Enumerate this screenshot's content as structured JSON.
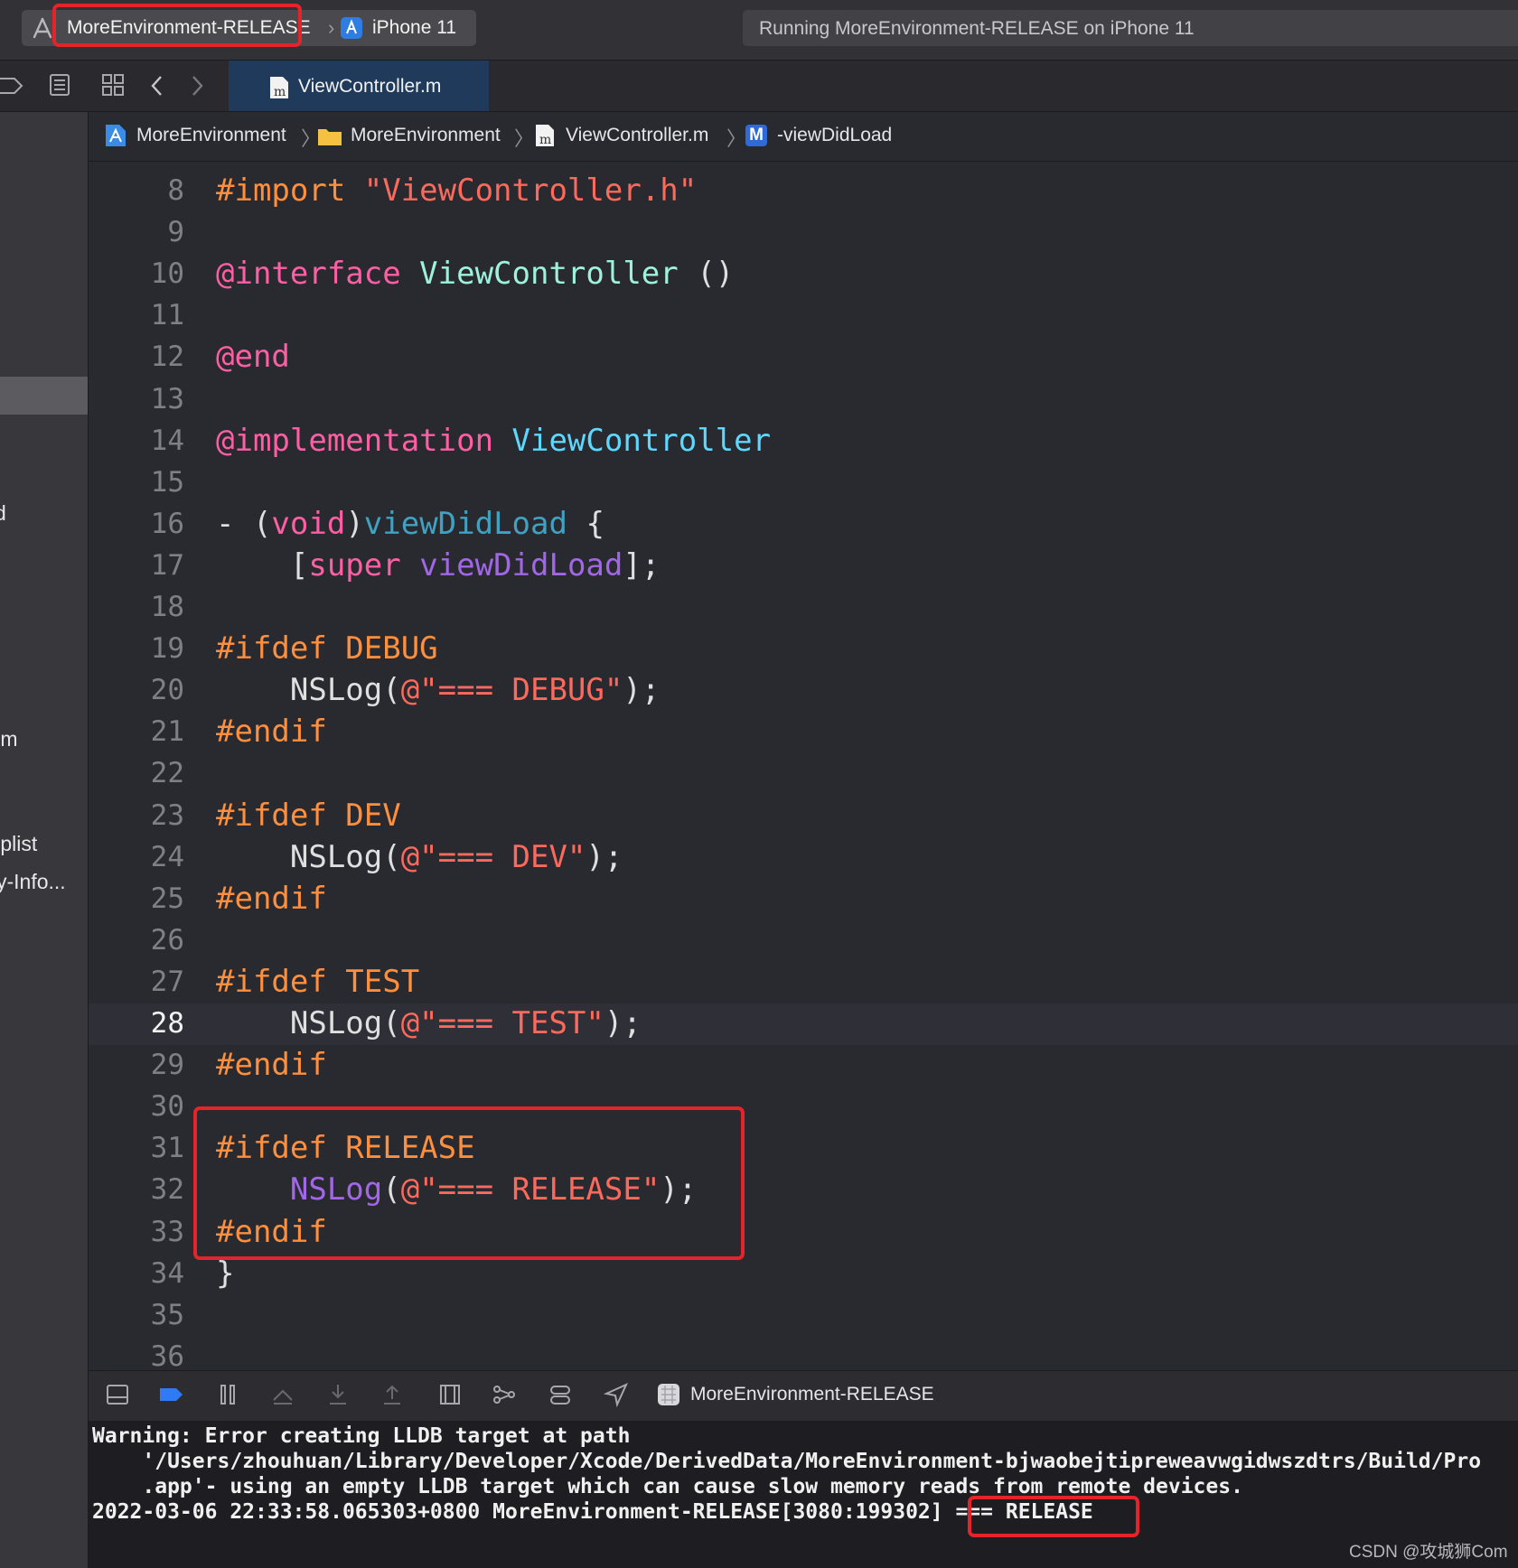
{
  "toolbar": {
    "scheme_name": "MoreEnvironment-RELEASE",
    "device_name": "iPhone 11",
    "status_text": "Running MoreEnvironment-RELEASE on iPhone 11"
  },
  "sidebar": {
    "fragments": [
      "d",
      ".m",
      ".plist",
      "y-Info..."
    ]
  },
  "tabs": [
    {
      "label": "ViewController.m"
    }
  ],
  "jumpbar": {
    "crumbs": [
      "MoreEnvironment",
      "MoreEnvironment",
      "ViewController.m",
      "-viewDidLoad"
    ],
    "method_badge": "M",
    "file_badge": "m"
  },
  "editor": {
    "current_line": 28,
    "lines": [
      {
        "n": "8"
      },
      {
        "n": "9"
      },
      {
        "n": "10"
      },
      {
        "n": "11"
      },
      {
        "n": "12"
      },
      {
        "n": "13"
      },
      {
        "n": "14"
      },
      {
        "n": "15"
      },
      {
        "n": "16"
      },
      {
        "n": "17"
      },
      {
        "n": "18"
      },
      {
        "n": "19"
      },
      {
        "n": "20"
      },
      {
        "n": "21"
      },
      {
        "n": "22"
      },
      {
        "n": "23"
      },
      {
        "n": "24"
      },
      {
        "n": "25"
      },
      {
        "n": "26"
      },
      {
        "n": "27"
      },
      {
        "n": "28"
      },
      {
        "n": "29"
      },
      {
        "n": "30"
      },
      {
        "n": "31"
      },
      {
        "n": "32"
      },
      {
        "n": "33"
      },
      {
        "n": "34"
      },
      {
        "n": "35"
      },
      {
        "n": "36"
      }
    ],
    "code": {
      "l8": [
        [
          "#import ",
          "pre"
        ],
        [
          "\"ViewController.h\"",
          "str"
        ]
      ],
      "l10": [
        [
          "@interface ",
          "kw"
        ],
        [
          "ViewController",
          "type2"
        ],
        [
          " ()",
          "plain"
        ]
      ],
      "l12": [
        [
          "@end",
          "kw"
        ]
      ],
      "l14": [
        [
          "@implementation ",
          "kw"
        ],
        [
          "ViewController",
          "type"
        ]
      ],
      "l16": [
        [
          "- (",
          "plain"
        ],
        [
          "void",
          "kw"
        ],
        [
          ")",
          "plain"
        ],
        [
          "viewDidLoad",
          "teal"
        ],
        [
          " {",
          "plain"
        ]
      ],
      "l17": [
        [
          "    [",
          "plain"
        ],
        [
          "super",
          "kw"
        ],
        [
          " ",
          "plain"
        ],
        [
          "viewDidLoad",
          "func"
        ],
        [
          "];",
          "plain"
        ]
      ],
      "l19": [
        [
          "#ifdef DEBUG",
          "pre"
        ]
      ],
      "l20": [
        [
          "    NSLog(",
          "plain"
        ],
        [
          "@\"=== DEBUG\"",
          "str"
        ],
        [
          ");",
          "plain"
        ]
      ],
      "l21": [
        [
          "#endif",
          "pre"
        ]
      ],
      "l23": [
        [
          "#ifdef DEV",
          "pre"
        ]
      ],
      "l24": [
        [
          "    NSLog(",
          "plain"
        ],
        [
          "@\"=== DEV\"",
          "str"
        ],
        [
          ");",
          "plain"
        ]
      ],
      "l25": [
        [
          "#endif",
          "pre"
        ]
      ],
      "l27": [
        [
          "#ifdef TEST",
          "pre"
        ]
      ],
      "l28": [
        [
          "    NSLog(",
          "plain"
        ],
        [
          "@\"=== TEST\"",
          "str"
        ],
        [
          ");",
          "plain"
        ]
      ],
      "l29": [
        [
          "#endif",
          "pre"
        ]
      ],
      "l31": [
        [
          "#ifdef RELEASE",
          "pre"
        ]
      ],
      "l32": [
        [
          "    ",
          "plain"
        ],
        [
          "NSLog",
          "func"
        ],
        [
          "(",
          "plain"
        ],
        [
          "@\"=== RELEASE\"",
          "str"
        ],
        [
          ");",
          "plain"
        ]
      ],
      "l33": [
        [
          "#endif",
          "pre"
        ]
      ],
      "l34": [
        [
          "}",
          "plain"
        ]
      ]
    }
  },
  "debugbar": {
    "process_label": "MoreEnvironment-RELEASE"
  },
  "console": {
    "lines": [
      "Warning: Error creating LLDB target at path",
      "    '/Users/zhouhuan/Library/Developer/Xcode/DerivedData/MoreEnvironment-bjwaobejtipreweavwgidwszdtrs/Build/Pro",
      "    .app'- using an empty LLDB target which can cause slow memory reads from remote devices.",
      "2022-03-06 22:33:58.065303+0800 MoreEnvironment-RELEASE[3080:199302] === RELEASE"
    ]
  },
  "watermark": "CSDN @攻城狮Com",
  "colors": {
    "highlight_box": "#e3242b",
    "preprocessor": "#fd8f3f",
    "string": "#fc6a5d",
    "keyword": "#fc5fa3",
    "type": "#5dd8ff",
    "selected_tab": "#1f3a5a"
  }
}
